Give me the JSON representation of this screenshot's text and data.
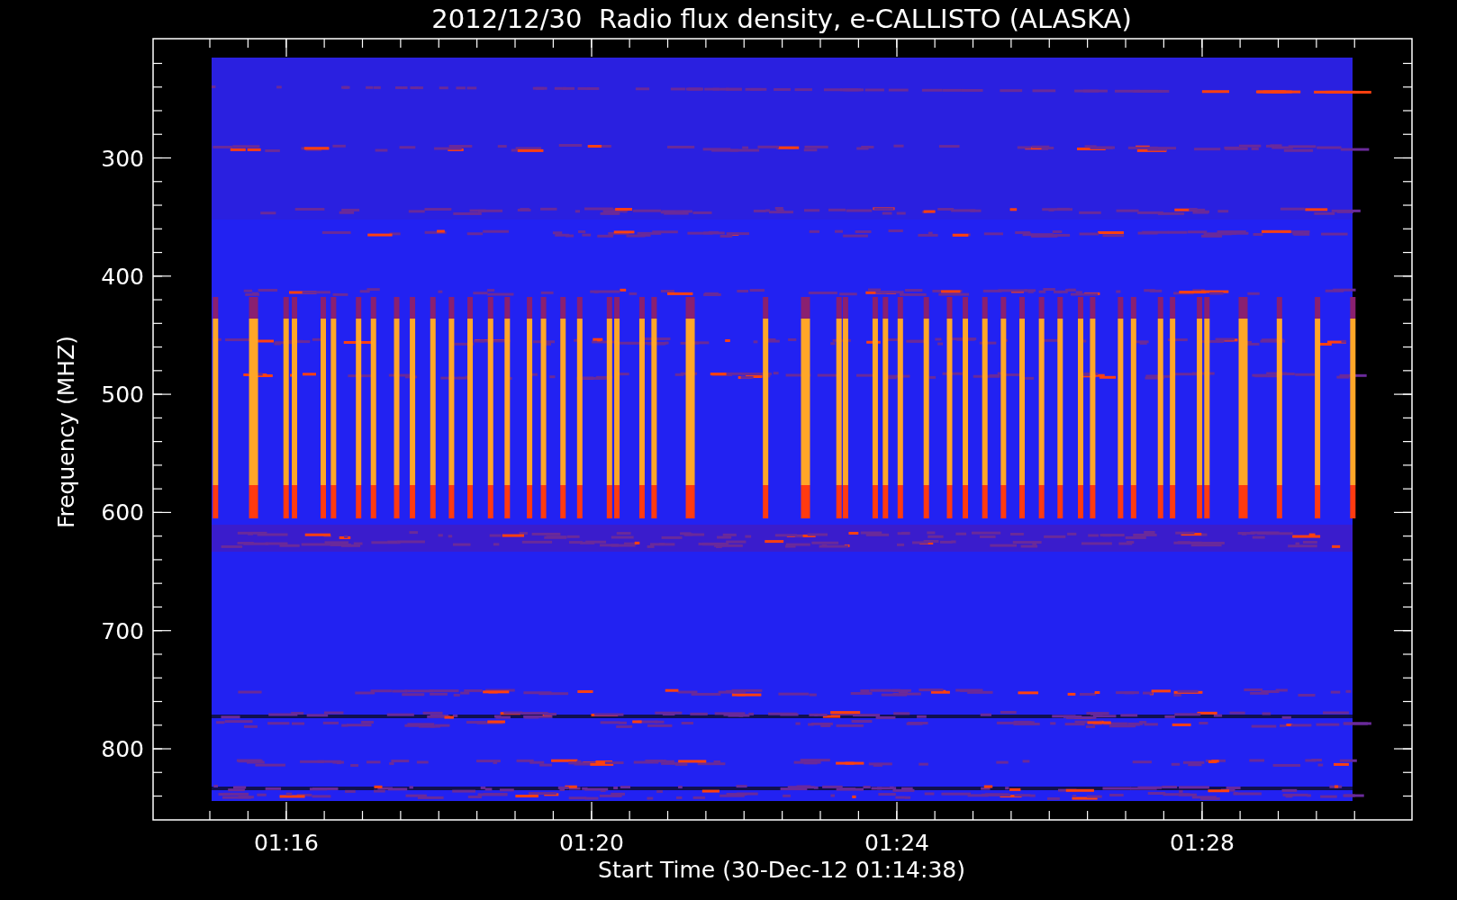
{
  "chart": {
    "title": "2012/12/30  Radio flux density, e-CALLISTO (ALASKA)",
    "ylabel": "Frequency (MHZ)",
    "xlabel": "Start Time (30-Dec-12 01:14:38)",
    "yticks": [
      "300",
      "400",
      "500",
      "600",
      "700",
      "800"
    ],
    "xticks": [
      "01:16",
      "01:20",
      "01:24",
      "01:28"
    ]
  }
}
